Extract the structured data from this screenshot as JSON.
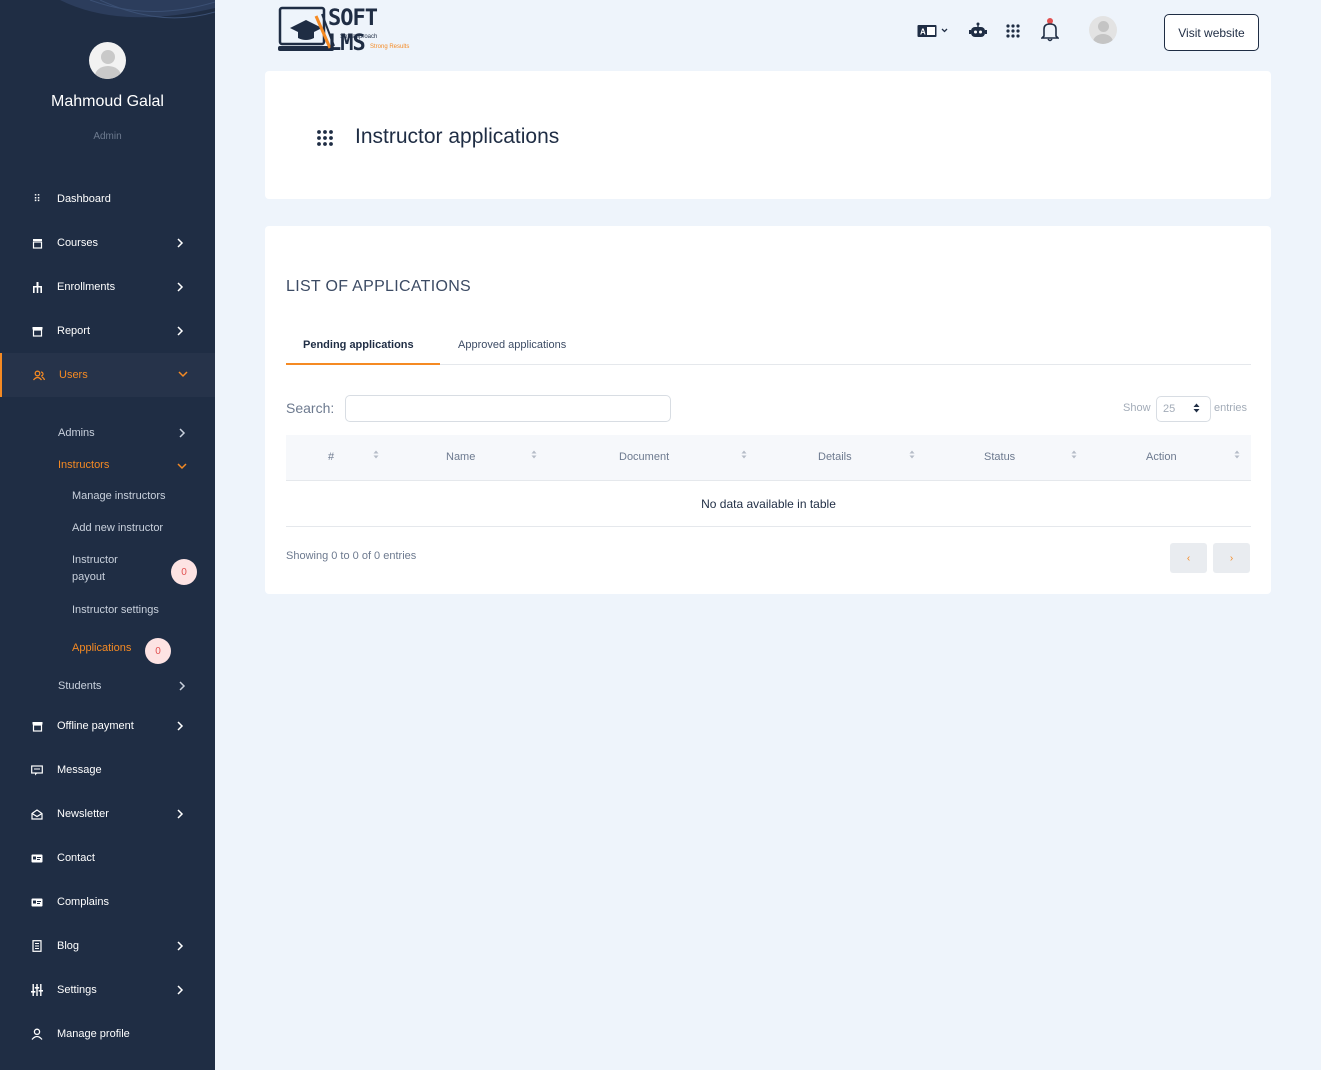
{
  "user": {
    "name": "Mahmoud Galal",
    "role": "Admin"
  },
  "logo": {
    "brand": "SOFT LMS",
    "tagline1": "Soft approach",
    "tagline2": "Strong Results"
  },
  "nav": {
    "dashboard": "Dashboard",
    "courses": "Courses",
    "enrollments": "Enrollments",
    "report": "Report",
    "users": "Users",
    "admins": "Admins",
    "instructors": "Instructors",
    "manage_instructors": "Manage instructors",
    "add_new_instructor": "Add new instructor",
    "instructor_payout_1": "Instructor",
    "instructor_payout_2": "payout",
    "instructor_payout_badge": "0",
    "instructor_settings": "Instructor settings",
    "applications": "Applications",
    "applications_badge": "0",
    "students": "Students",
    "offline_payment": "Offline payment",
    "message": "Message",
    "newsletter": "Newsletter",
    "contact": "Contact",
    "complains": "Complains",
    "blog": "Blog",
    "settings": "Settings",
    "manage_profile": "Manage profile"
  },
  "header": {
    "visit_website": "Visit website"
  },
  "page": {
    "title": "Instructor applications"
  },
  "list": {
    "heading": "LIST OF APPLICATIONS",
    "tabs": [
      "Pending applications",
      "Approved applications"
    ],
    "search_label": "Search:",
    "show_label": "Show",
    "entries_value": "25",
    "entries_label": "entries",
    "columns": [
      "#",
      "Name",
      "Document",
      "Details",
      "Status",
      "Action"
    ],
    "empty_text": "No data available in table",
    "showing": "Showing 0 to 0 of 0 entries",
    "prev": "‹",
    "next": "›"
  },
  "colors": {
    "sidebar": "#1f2d44",
    "accent": "#f58a23",
    "background": "#eef4fb"
  }
}
